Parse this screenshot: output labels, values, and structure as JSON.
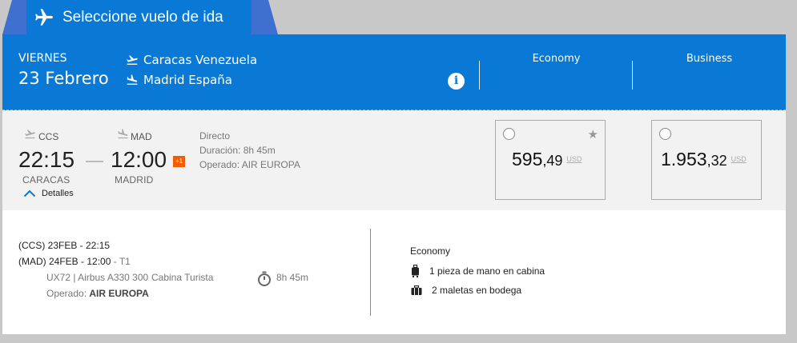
{
  "header": {
    "title": "Seleccione vuelo de ida"
  },
  "date": {
    "day_name": "VIERNES",
    "date_text": "23 Febrero"
  },
  "route": {
    "origin": "Caracas Venezuela",
    "destination": "Madrid España"
  },
  "cabins": [
    "Economy",
    "Business"
  ],
  "flight": {
    "departure_code": "CCS",
    "departure_time": "22:15",
    "departure_city": "CARACAS",
    "arrival_code": "MAD",
    "arrival_time": "12:00",
    "arrival_city": "MADRID",
    "next_day_badge": "+1",
    "stops": "Directo",
    "duration_label": "Duración:",
    "duration_value": "8h 45m",
    "operated_label": "Operado:",
    "operated_value": "AIR EUROPA",
    "details_label": "Detalles"
  },
  "fares": [
    {
      "cabin": "Economy",
      "integer": "595",
      "decimal": ",49",
      "currency": "USD",
      "starred": true
    },
    {
      "cabin": "Business",
      "integer": "1.953",
      "decimal": ",32",
      "currency": "USD",
      "starred": false
    }
  ],
  "details": {
    "dep_line": "(CCS) 23FEB - 22:15",
    "arr_line": "(MAD) 24FEB - 12:00",
    "arr_terminal": "- T1",
    "flight_info": "UX72 | Airbus A330 300",
    "cabin_info": "Cabina Turista",
    "duration": "8h 45m",
    "operated_label": "Operado:",
    "operated_value": "AIR EUROPA",
    "fare_cabin": "Economy",
    "carry_on": "1 pieza de mano en cabina",
    "checked": "2 maletas en bodega"
  },
  "colors": {
    "primary_blue": "#0a79d6",
    "tab_edge": "#3f6fcf",
    "next_day_orange": "#f25c05"
  }
}
